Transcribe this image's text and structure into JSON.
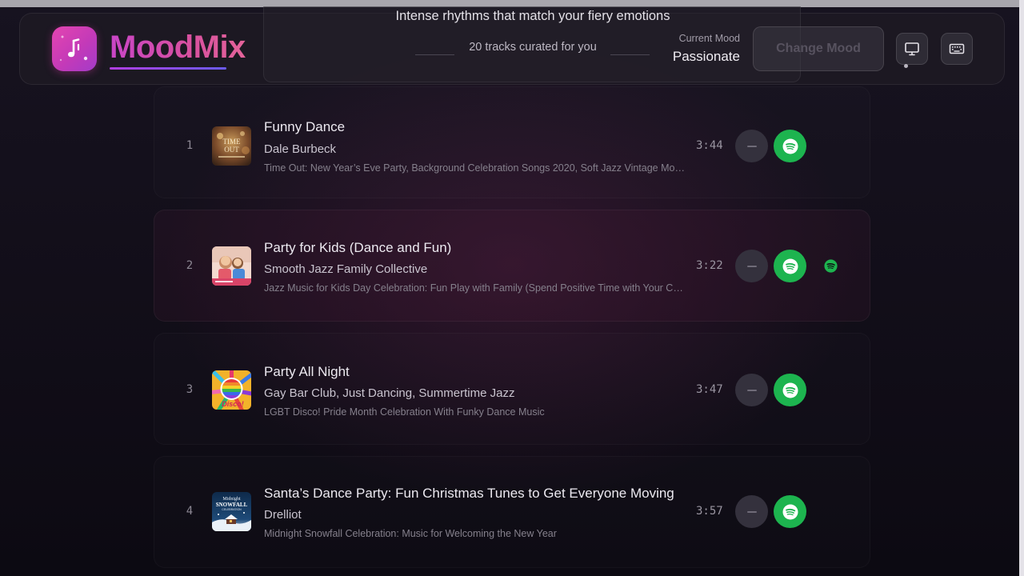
{
  "app": {
    "name": "MoodMix",
    "tagline": "Intense rhythms that match your fiery emotions",
    "track_count_label": "20 tracks curated for you"
  },
  "mood": {
    "label": "Current Mood",
    "value": "Passionate",
    "change_button": "Change Mood"
  },
  "header_icons": {
    "monitor": "monitor-icon",
    "keyboard": "keyboard-icon",
    "logo": "music-note-icon"
  },
  "colors": {
    "accent_pink": "#d94ab6",
    "spotify_green": "#1db44f",
    "remove_button": "#34313d"
  },
  "tracks": [
    {
      "number": "1",
      "title": "Funny Dance",
      "artist": "Dale Burbeck",
      "album": "Time Out: New Year’s Eve Party, Background Celebration Songs 2020, Soft Jazz Vintage Mood",
      "duration": "3:44",
      "cover_text": "TIME OUT"
    },
    {
      "number": "2",
      "title": "Party for Kids (Dance and Fun)",
      "artist": "Smooth Jazz Family Collective",
      "album": "Jazz Music for Kids Day Celebration: Fun Play with Family (Spend Positive Time with Your Children)",
      "duration": "3:22",
      "cover_text": ""
    },
    {
      "number": "3",
      "title": "Party All Night",
      "artist": "Gay Bar Club, Just Dancing, Summertime Jazz",
      "album": "LGBT Disco! Pride Month Celebration With Funky Dance Music",
      "duration": "3:47",
      "cover_text": "Disco!"
    },
    {
      "number": "4",
      "title": "Santa’s Dance Party: Fun Christmas Tunes to Get Everyone Moving",
      "artist": "Drelliot",
      "album": "Midnight Snowfall Celebration: Music for Welcoming the New Year",
      "duration": "3:57",
      "cover_text": "Midnight SNOWFALL CELEBRATION"
    }
  ]
}
